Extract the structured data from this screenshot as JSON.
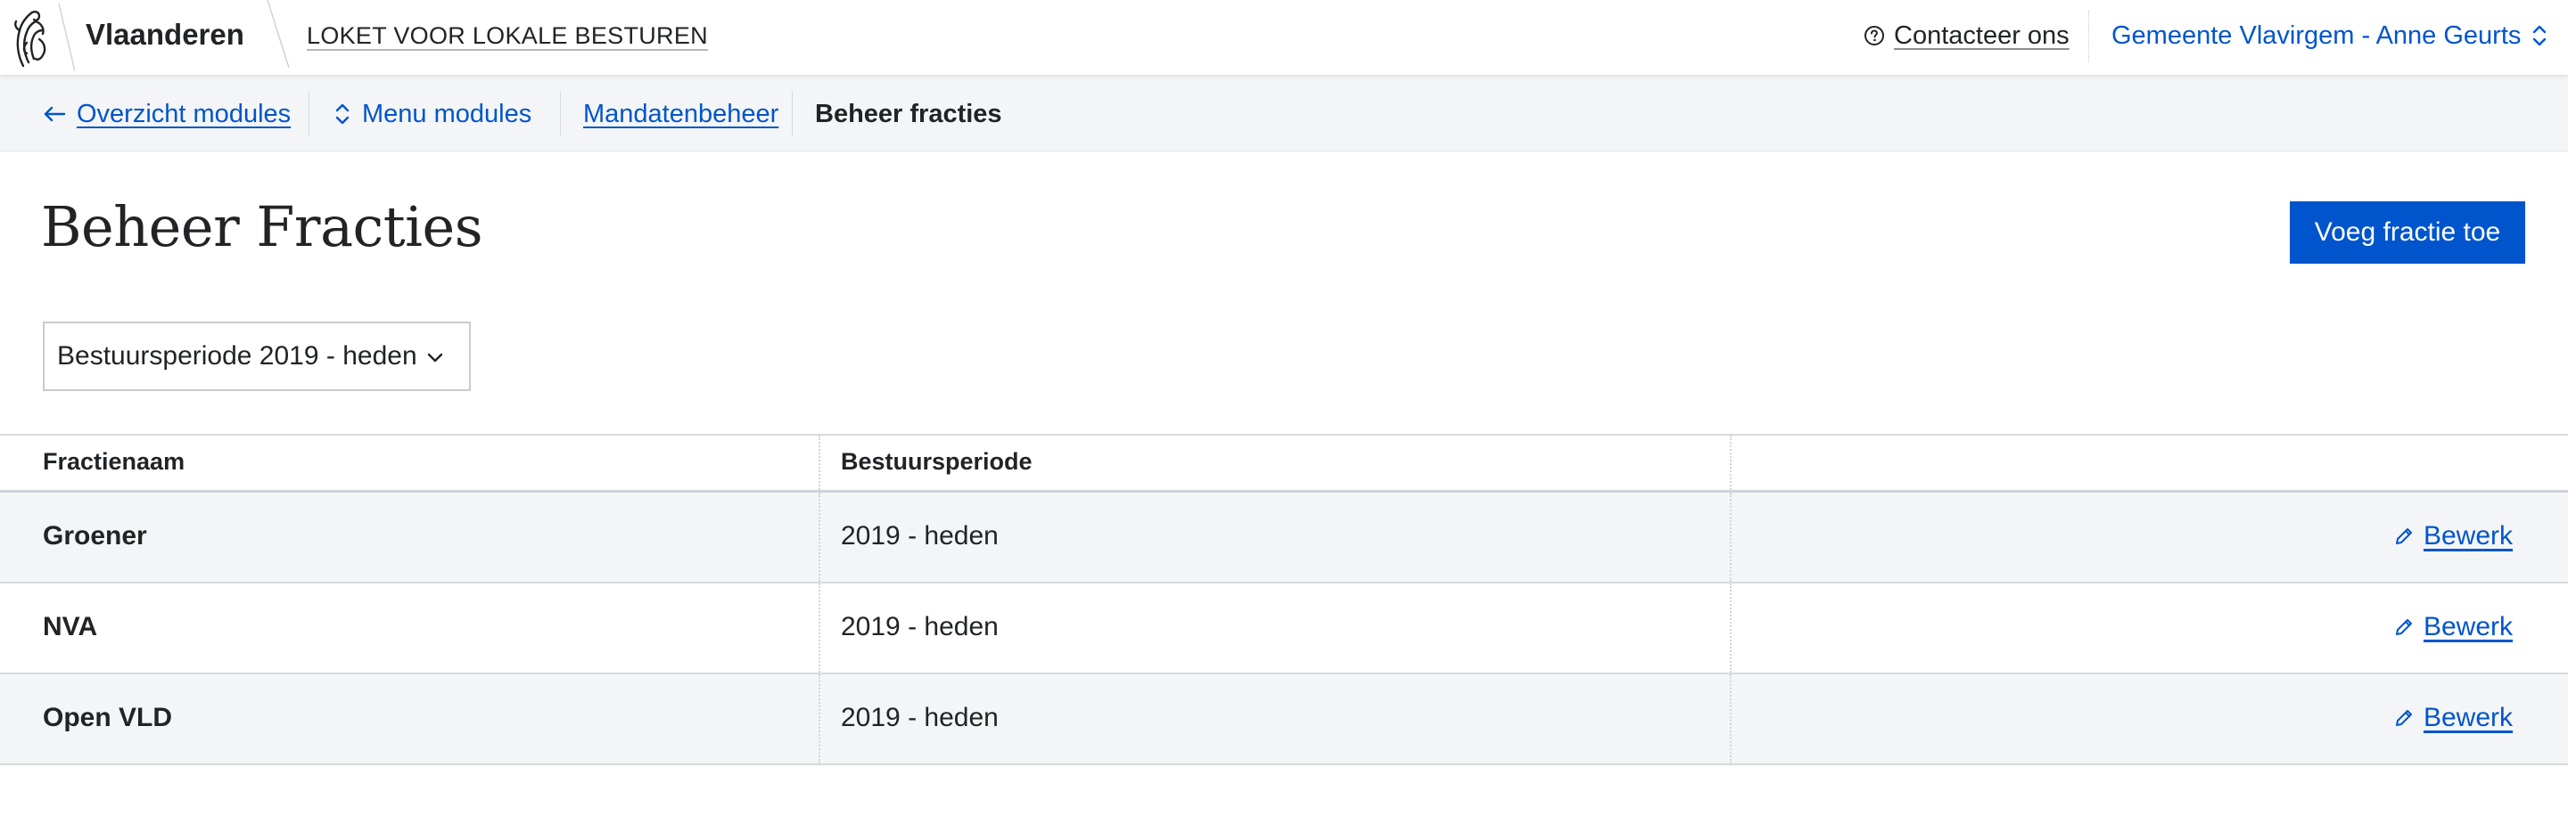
{
  "header": {
    "brand": "Vlaanderen",
    "app_title": "LOKET VOOR LOKALE BESTUREN",
    "contact_label": "Contacteer ons",
    "account_label": "Gemeente Vlavirgem - Anne Geurts"
  },
  "toolbar": {
    "back_label": "Overzicht modules",
    "menu_label": "Menu modules",
    "breadcrumb": {
      "parent": "Mandatenbeheer",
      "current": "Beheer fracties"
    }
  },
  "page": {
    "title": "Beheer Fracties",
    "add_button_label": "Voeg fractie toe",
    "period_select": {
      "selected": "Bestuursperiode 2019 - heden"
    }
  },
  "table": {
    "columns": [
      "Fractienaam",
      "Bestuursperiode",
      ""
    ],
    "rows": [
      {
        "name": "Groener",
        "period": "2019 - heden",
        "action": "Bewerk"
      },
      {
        "name": "NVA",
        "period": "2019 - heden",
        "action": "Bewerk"
      },
      {
        "name": "Open VLD",
        "period": "2019 - heden",
        "action": "Bewerk"
      }
    ]
  },
  "icons": {
    "logo": "flemish-lion-logo",
    "contact": "question-circle-icon",
    "account": "chevron-updown-icon",
    "back": "arrow-left-icon",
    "menu": "chevron-updown-icon",
    "select": "chevron-down-icon",
    "edit": "pencil-icon"
  },
  "colors": {
    "primary": "#0055cc",
    "text": "#212326",
    "toolbar_bg": "#f4f5f6",
    "row_alt_bg": "#f4f5f6",
    "border": "#d7dadd"
  }
}
